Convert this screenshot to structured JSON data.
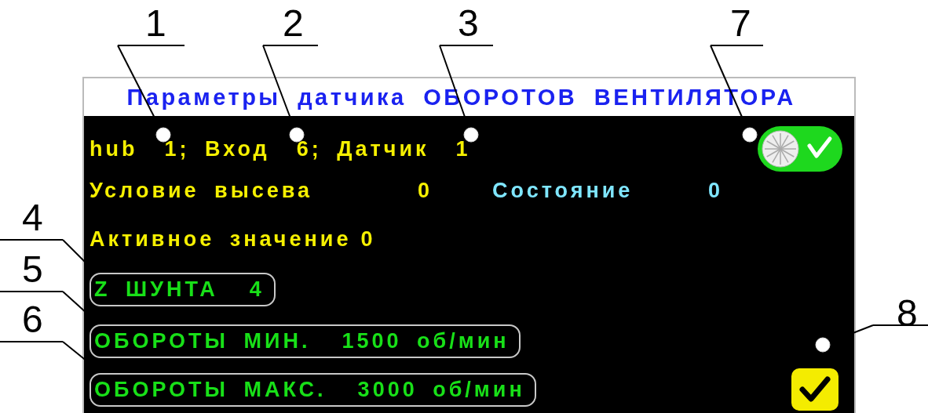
{
  "callouts": [
    {
      "label": "1"
    },
    {
      "label": "2"
    },
    {
      "label": "3"
    },
    {
      "label": "7"
    },
    {
      "label": "4"
    },
    {
      "label": "5"
    },
    {
      "label": "6"
    },
    {
      "label": "8"
    }
  ],
  "screen": {
    "title": "Параметры датчика ОБОРОТОВ ВЕНТИЛЯТОРА",
    "sensor_line": [
      "hub",
      "1; Вход",
      "6; Датчик",
      "1"
    ],
    "seeding_condition": {
      "label": "Условие высева",
      "value": "0"
    },
    "state": {
      "label": "Состояние",
      "value": "0"
    },
    "active_value": {
      "label": "Активное значение",
      "value": "0"
    },
    "params": [
      {
        "label": "Z ШУНТА",
        "value": "4"
      },
      {
        "label": "ОБОРОТЫ МИН.",
        "value": "1500",
        "unit": "об/мин"
      },
      {
        "label": "ОБОРОТЫ МАКС.",
        "value": "3000",
        "unit": "об/мин"
      }
    ],
    "toggle": {
      "on": true
    },
    "confirm_checkbox": {
      "checked": true
    }
  }
}
